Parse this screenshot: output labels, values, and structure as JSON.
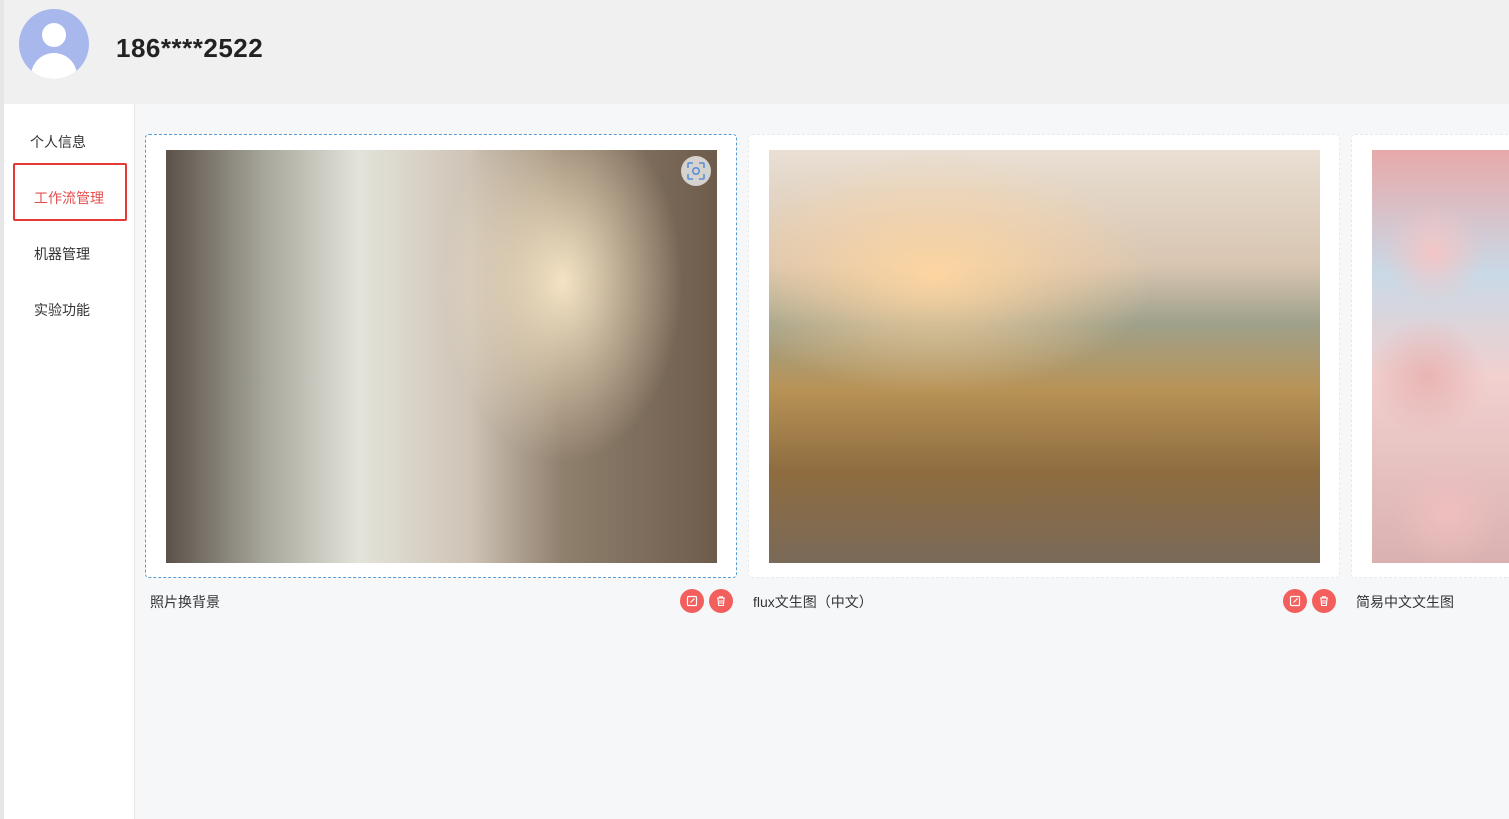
{
  "header": {
    "username": "186****2522"
  },
  "sidebar": {
    "items": [
      {
        "label": "个人信息"
      },
      {
        "label": "工作流管理"
      },
      {
        "label": "机器管理"
      },
      {
        "label": "实验功能"
      }
    ],
    "active_index": 1
  },
  "workflows": [
    {
      "title": "照片换背景",
      "selected": true
    },
    {
      "title": "flux文生图（中文）",
      "selected": false
    },
    {
      "title": "简易中文文生图",
      "selected": false
    }
  ],
  "icons": {
    "scan": "scan-focus-icon",
    "edit": "edit-icon",
    "delete": "trash-icon"
  },
  "colors": {
    "accent_red": "#f25f5c",
    "active_text": "#e5504e",
    "selected_border": "#5a9bd5",
    "avatar": "#a9b8ec"
  }
}
